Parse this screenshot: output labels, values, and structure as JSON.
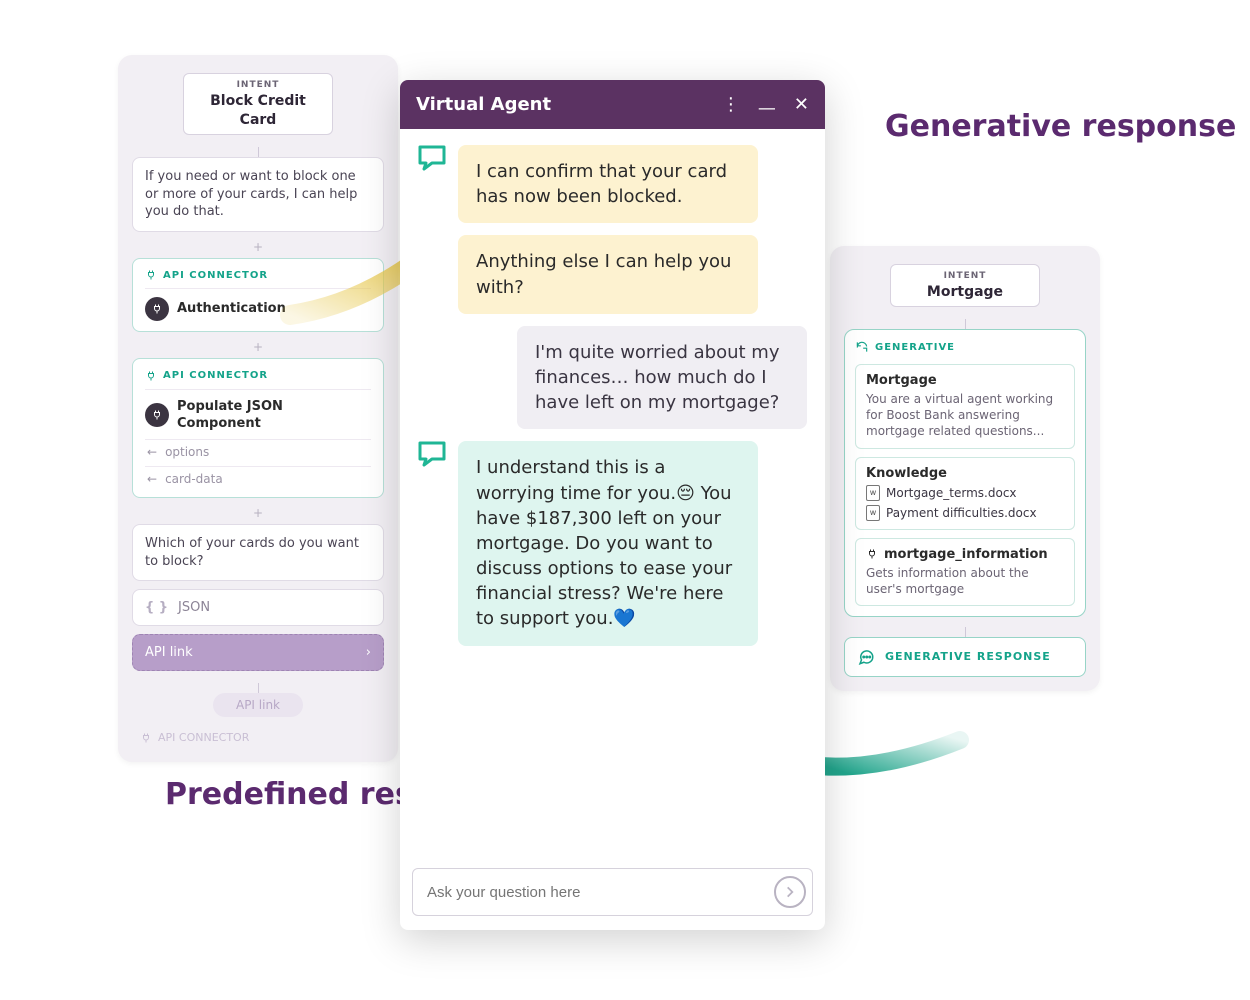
{
  "labels": {
    "predefined_title": "Predefined response",
    "generative_title": "Generative response"
  },
  "left": {
    "intent_eyebrow": "INTENT",
    "intent_title": "Block Credit Card",
    "node1_text": "If you need or want to block one or more of your cards, I can help you do that.",
    "api_connector_label": "API CONNECTOR",
    "node2_auth": "Authentication",
    "node3_title": "Populate JSON Component",
    "node3_opt1": "options",
    "node3_opt2": "card-data",
    "node4_text": "Which of your cards do you want to block?",
    "json_label": "JSON",
    "api_link_active": "API link",
    "api_link_inactive": "API link"
  },
  "chat": {
    "header_title": "Virtual Agent",
    "msg1": "I can confirm that your card has now been blocked.",
    "msg2": "Anything else I can help you with?",
    "msg3": "I'm quite worried about my finances… how much do I have left on my mortgage?",
    "msg4": "I understand this is a worrying time for you.😔 You have $187,300 left on your mortgage. Do you want to discuss options to ease your financial stress? We're here to support you.💙",
    "input_placeholder": "Ask your question here"
  },
  "right": {
    "intent_eyebrow": "INTENT",
    "intent_title": "Mortgage",
    "generative_label": "GENERATIVE",
    "card1_title": "Mortgage",
    "card1_text": "You are a virtual agent working for Boost Bank answering mortgage related questions...",
    "card2_title": "Knowledge",
    "doc1": "Mortgage_terms.docx",
    "doc2": "Payment difficulties.docx",
    "card3_title": "mortgage_information",
    "card3_text": "Gets information about the user's mortgage",
    "gen_response_label": "GENERATIVE RESPONSE"
  }
}
